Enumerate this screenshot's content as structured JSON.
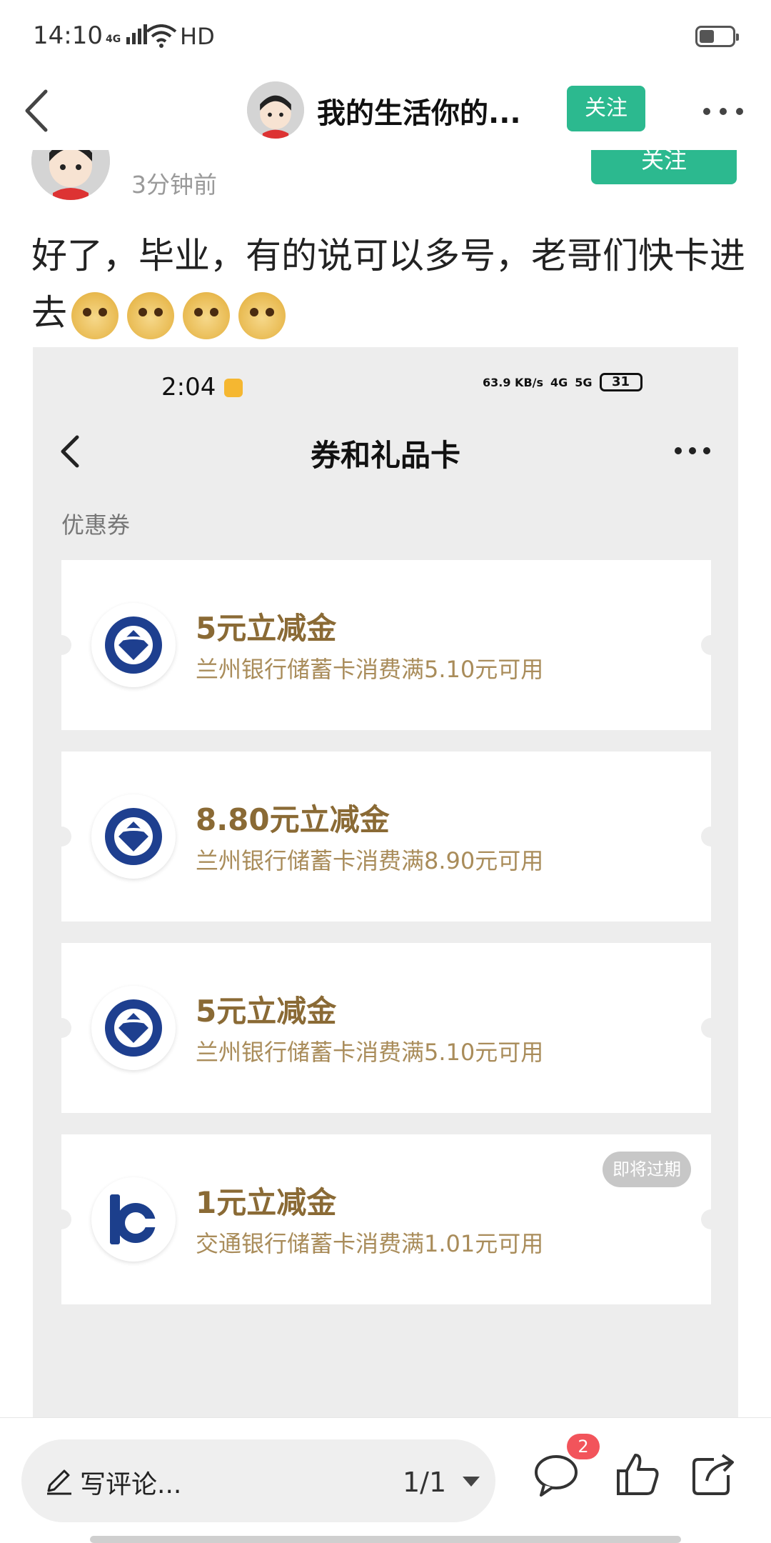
{
  "status_bar": {
    "time": "14:10",
    "network": "4G",
    "hd": "HD"
  },
  "nav": {
    "title": "我的生活你的...",
    "follow": "关注"
  },
  "post": {
    "time_ago": "3分钟前",
    "follow": "关注",
    "text": "好了，毕业，有的说可以多号，老哥们快卡进去"
  },
  "embedded": {
    "status": {
      "time": "2:04",
      "speed": "63.9 KB/s",
      "net1": "4G",
      "net2": "5G",
      "battery": "31"
    },
    "title": "券和礼品卡",
    "section": "优惠券",
    "coupons": [
      {
        "title": "5元立减金",
        "desc": "兰州银行储蓄卡消费满5.10元可用",
        "badge": "",
        "bank_icon": "lanzhou-bank-logo-icon"
      },
      {
        "title": "8.80元立减金",
        "desc": "兰州银行储蓄卡消费满8.90元可用",
        "badge": "",
        "bank_icon": "lanzhou-bank-logo-icon"
      },
      {
        "title": "5元立减金",
        "desc": "兰州银行储蓄卡消费满5.10元可用",
        "badge": "",
        "bank_icon": "lanzhou-bank-logo-icon"
      },
      {
        "title": "1元立减金",
        "desc": "交通银行储蓄卡消费满1.01元可用",
        "badge": "即将过期",
        "bank_icon": "bocom-logo-icon"
      }
    ]
  },
  "bottom": {
    "comment_placeholder": "写评论...",
    "page_indicator": "1/1",
    "comment_badge": "2"
  },
  "colors": {
    "accent": "#2cb98f",
    "coupon_title": "#8a6a35",
    "badge": "#f2545b"
  }
}
